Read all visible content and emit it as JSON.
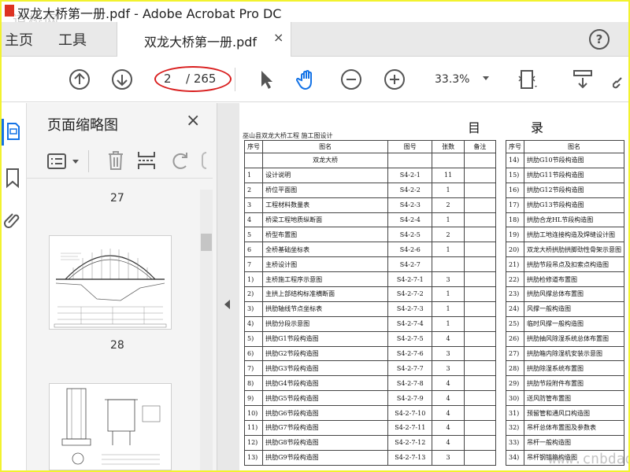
{
  "window": {
    "title": "双龙大桥第一册.pdf - Adobe Acrobat Pro DC",
    "watermark": "道桥网"
  },
  "tabs": {
    "home": "主页",
    "tools": "工具",
    "document": "双龙大桥第一册.pdf",
    "close": "×",
    "help": "?"
  },
  "toolbar": {
    "current_page": "2",
    "total_pages": "/ 265",
    "zoom": "33.3%",
    "icons": [
      "page-up-icon",
      "page-down-icon",
      "select-cursor-icon",
      "hand-tool-icon",
      "zoom-out-icon",
      "zoom-in-icon",
      "fit-page-icon",
      "scroll-mode-icon",
      "link-icon"
    ],
    "highlight_color": "#d91e1e"
  },
  "thumbnails": {
    "heading": "页面缩略图",
    "close": "×",
    "pages": [
      "27",
      "28"
    ]
  },
  "document": {
    "header": "巫山县双龙大桥工程  施工图设计",
    "title": "目录",
    "columns": [
      "序号",
      "图名",
      "图号",
      "张数",
      "备注"
    ],
    "right_columns": [
      "序号",
      "图名"
    ],
    "section": "双龙大桥",
    "rows": [
      {
        "no": "1",
        "name": "设计说明",
        "code": "S4-2-1",
        "count": "11"
      },
      {
        "no": "2",
        "name": "桥位平面图",
        "code": "S4-2-2",
        "count": "1"
      },
      {
        "no": "3",
        "name": "工程材料数量表",
        "code": "S4-2-3",
        "count": "2"
      },
      {
        "no": "4",
        "name": "桥梁工程地质纵断面",
        "code": "S4-2-4",
        "count": "1"
      },
      {
        "no": "5",
        "name": "桥型布置图",
        "code": "S4-2-5",
        "count": "2"
      },
      {
        "no": "6",
        "name": "全桥基础坐标表",
        "code": "S4-2-6",
        "count": "1"
      },
      {
        "no": "7",
        "name": "主桥设计图",
        "code": "S4-2-7",
        "count": ""
      },
      {
        "no": "1)",
        "name": "主桥施工程序示意图",
        "code": "S4-2-7-1",
        "count": "3"
      },
      {
        "no": "2)",
        "name": "主拱上部结构标准横断面",
        "code": "S4-2-7-2",
        "count": "1"
      },
      {
        "no": "3)",
        "name": "拱肋轴线节点坐标表",
        "code": "S4-2-7-3",
        "count": "1"
      },
      {
        "no": "4)",
        "name": "拱肋分段示意图",
        "code": "S4-2-7-4",
        "count": "1"
      },
      {
        "no": "5)",
        "name": "拱肋G1节段构造图",
        "code": "S4-2-7-5",
        "count": "4"
      },
      {
        "no": "6)",
        "name": "拱肋G2节段构造图",
        "code": "S4-2-7-6",
        "count": "3"
      },
      {
        "no": "7)",
        "name": "拱肋G3节段构造图",
        "code": "S4-2-7-7",
        "count": "3"
      },
      {
        "no": "8)",
        "name": "拱肋G4节段构造图",
        "code": "S4-2-7-8",
        "count": "4"
      },
      {
        "no": "9)",
        "name": "拱肋G5节段构造图",
        "code": "S4-2-7-9",
        "count": "4"
      },
      {
        "no": "10)",
        "name": "拱肋G6节段构造图",
        "code": "S4-2-7-10",
        "count": "4"
      },
      {
        "no": "11)",
        "name": "拱肋G7节段构造图",
        "code": "S4-2-7-11",
        "count": "4"
      },
      {
        "no": "12)",
        "name": "拱肋G8节段构造图",
        "code": "S4-2-7-12",
        "count": "4"
      },
      {
        "no": "13)",
        "name": "拱肋G9节段构造图",
        "code": "S4-2-7-13",
        "count": "3"
      }
    ],
    "right_rows": [
      {
        "no": "14)",
        "name": "拱肋G10节段构造图"
      },
      {
        "no": "15)",
        "name": "拱肋G11节段构造图"
      },
      {
        "no": "16)",
        "name": "拱肋G12节段构造图"
      },
      {
        "no": "17)",
        "name": "拱肋G13节段构造图"
      },
      {
        "no": "18)",
        "name": "拱肋合龙HL节段构造图"
      },
      {
        "no": "19)",
        "name": "拱肋工地连接构造及焊缝设计图"
      },
      {
        "no": "20)",
        "name": "双龙大桥拱肋拱脚劲性骨架示意图"
      },
      {
        "no": "21)",
        "name": "拱肋节段吊点及扣索点构造图"
      },
      {
        "no": "22)",
        "name": "拱肋检修道布置图"
      },
      {
        "no": "23)",
        "name": "拱肋风撑总体布置图"
      },
      {
        "no": "24)",
        "name": "风撑一般构造图"
      },
      {
        "no": "25)",
        "name": "临时风撑一般构造图"
      },
      {
        "no": "26)",
        "name": "拱肋抽风除湿系统总体布置图"
      },
      {
        "no": "27)",
        "name": "拱肋箱内除湿机安装示意图"
      },
      {
        "no": "28)",
        "name": "拱肋除湿系统布置图"
      },
      {
        "no": "29)",
        "name": "拱肋节段附件布置图"
      },
      {
        "no": "30)",
        "name": "送风防管布置图"
      },
      {
        "no": "31)",
        "name": "预留管和通风口构造图"
      },
      {
        "no": "32)",
        "name": "吊杆总体布置图及参数表"
      },
      {
        "no": "33)",
        "name": "吊杆一般构造图"
      },
      {
        "no": "34)",
        "name": "吊杆钢锚箱构造图"
      }
    ],
    "watermark": "www.cnbdao.com"
  }
}
